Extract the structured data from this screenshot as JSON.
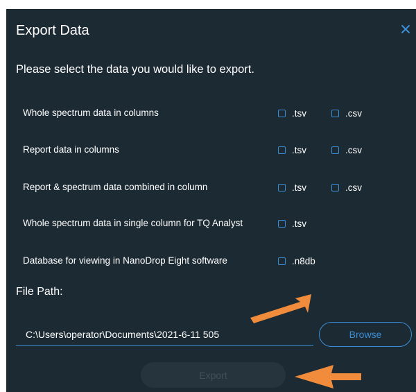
{
  "dialog": {
    "title": "Export Data",
    "subtitle": "Please select the data you would like to export.",
    "close_icon": "close-icon"
  },
  "export_options": [
    {
      "label": "Whole spectrum data in columns",
      "formats": [
        ".tsv",
        ".csv"
      ]
    },
    {
      "label": "Report data in columns",
      "formats": [
        ".tsv",
        ".csv"
      ]
    },
    {
      "label": "Report & spectrum data combined in column",
      "formats": [
        ".tsv",
        ".csv"
      ]
    },
    {
      "label": "Whole spectrum data in single column for TQ Analyst",
      "formats": [
        ".tsv"
      ]
    },
    {
      "label": "Database for viewing in NanoDrop Eight software",
      "formats": [
        ".n8db"
      ]
    }
  ],
  "file_path": {
    "label": "File Path:",
    "value": "C:\\Users\\operator\\Documents\\2021-6-11  505"
  },
  "buttons": {
    "browse": "Browse",
    "export": "Export"
  },
  "colors": {
    "background": "#1c2a33",
    "accent": "#3c8fd6",
    "annotation_arrow": "#f28c3d",
    "disabled_button": "#26343d"
  }
}
